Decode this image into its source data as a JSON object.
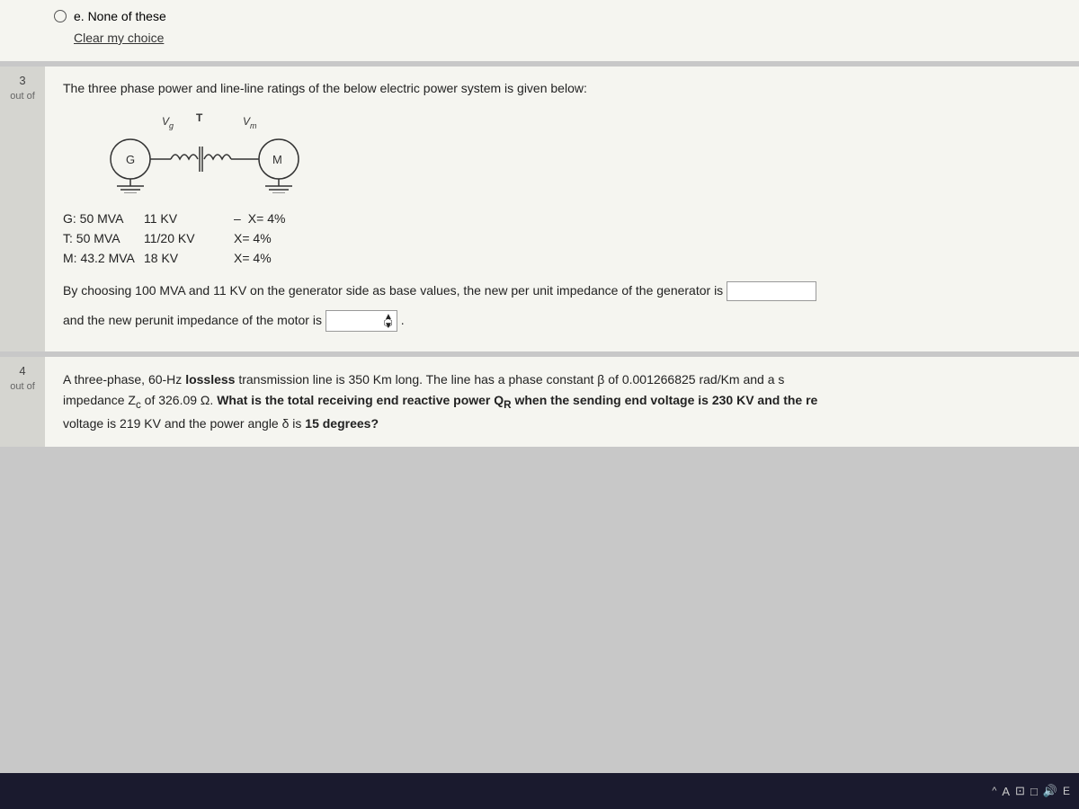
{
  "top_section": {
    "option_e": "e. None of these",
    "clear_link": "Clear my choice"
  },
  "question3": {
    "number": "3",
    "out_of": "out of",
    "intro": "The three phase power and line-line ratings of the below electric power system is given below:",
    "circuit": {
      "g_label": "G",
      "t_label": "T",
      "vg_label": "Vg",
      "vm_label": "Vm",
      "m_label": "M"
    },
    "specs": [
      {
        "label": "G:  50 MVA",
        "kv": "11 KV",
        "dash": "–",
        "x": "X= 4%"
      },
      {
        "label": "T:  50 MVA",
        "kv": "11/20 KV",
        "x": "X= 4%"
      },
      {
        "label": "M:  43.2 MVA",
        "kv": "18 KV",
        "x": "X= 4%"
      }
    ],
    "fill_text_1": "By choosing 100 MVA and 11 KV on the generator side as base values, the new per unit impedance of the generator is",
    "fill_text_2": "and the new perunit impedance of the motor is",
    "fill_placeholder": "",
    "period": "."
  },
  "question4": {
    "number": "4",
    "out_of": "out of",
    "text_intro": "A three-phase, 60-Hz ",
    "lossless": "lossless",
    "text_mid": " transmission line is 350 Km long. The line has a phase constant β of 0.001266825 rad/Km and a s",
    "text_mid2": "impedance Z",
    "text_sub": "c",
    "text_mid3": " of 326.09 Ω. ",
    "bold_text": "What is the total receiving end reactive power Q",
    "bold_sub": "R",
    "bold_text2": " when the sending end voltage is 230 KV and the re",
    "text_end2": "voltage is 219 KV and the power angle δ is ",
    "bold_degrees": "15 degrees?"
  },
  "taskbar": {
    "time": "E",
    "icons": [
      "^",
      "A",
      "⊡",
      "□",
      "🔊"
    ]
  }
}
